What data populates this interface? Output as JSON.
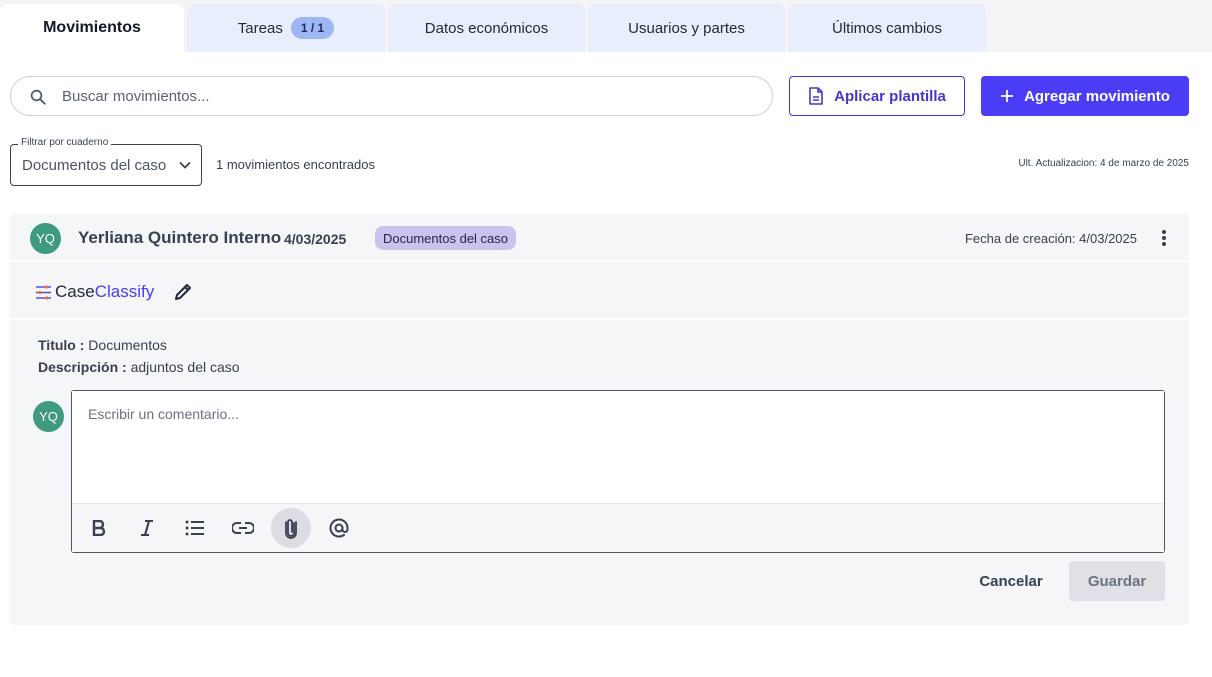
{
  "tabs": [
    {
      "label": "Movimientos",
      "active": true
    },
    {
      "label": "Tareas",
      "badge": "1 / 1"
    },
    {
      "label": "Datos económicos"
    },
    {
      "label": "Usuarios y partes"
    },
    {
      "label": "Últimos cambios"
    }
  ],
  "search": {
    "placeholder": "Buscar movimientos..."
  },
  "actions": {
    "apply_template": "Aplicar plantilla",
    "add_movement": "Agregar movimiento"
  },
  "filter": {
    "label": "Filtrar por cuaderno",
    "value": "Documentos del caso"
  },
  "results": {
    "count_text": "1 movimientos encontrados",
    "updated_text": "Ult. Actualizacion: 4 de marzo de 2025"
  },
  "movement": {
    "avatar": "YQ",
    "author": "Yerliana Quintero Interno",
    "date": "4/03/2025",
    "notebook": "Documentos del caso",
    "created": "Fecha de creación: 4/03/2025",
    "classify_logo": {
      "part1": "Case",
      "part2": "Classify"
    },
    "title_label": "Titulo :",
    "title_value": "Documentos",
    "description_label": "Descripción :",
    "description_value": "adjuntos del caso"
  },
  "comment": {
    "avatar": "YQ",
    "placeholder": "Escribir un comentario...",
    "cancel": "Cancelar",
    "save": "Guardar"
  },
  "colors": {
    "primary": "#4a3df5",
    "avatar": "#3f9a7e",
    "chip": "#c9c3ee",
    "tab_bg": "#e8eefc"
  }
}
